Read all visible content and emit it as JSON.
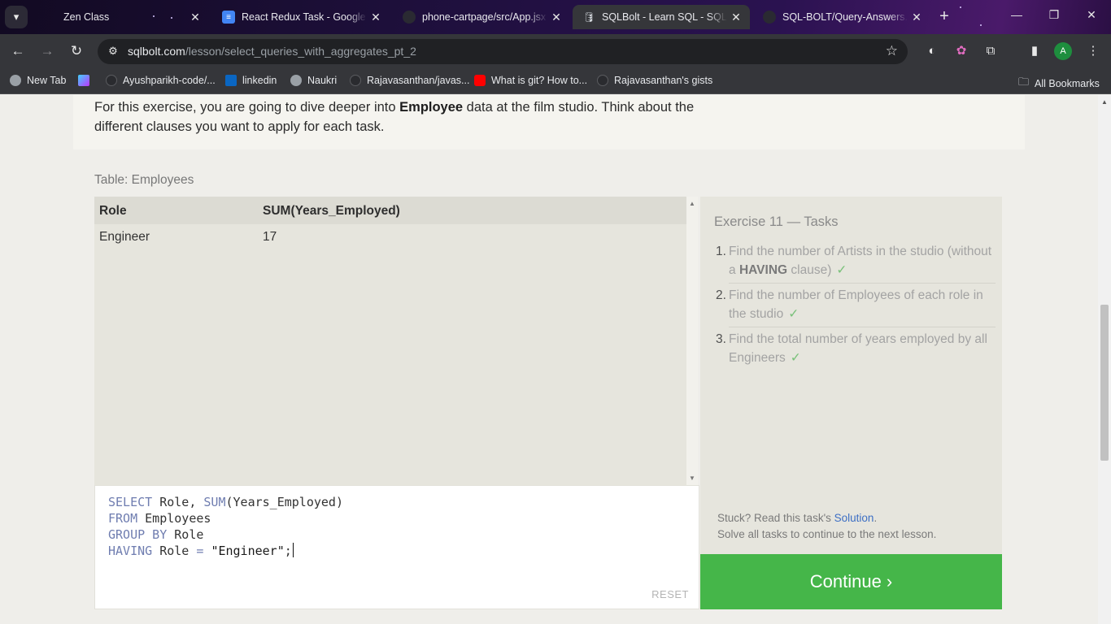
{
  "browser": {
    "tab_menu_icon": "chevron-down-icon",
    "tabs": [
      {
        "title": "Zen Class",
        "favicon": "zen-class-favicon",
        "active": false
      },
      {
        "title": "React Redux Task - Google D",
        "favicon": "google-docs-icon",
        "active": false
      },
      {
        "title": "phone-cartpage/src/App.jsx",
        "favicon": "github-icon",
        "active": false
      },
      {
        "title": "SQLBolt - Learn SQL - SQL L",
        "favicon": "database-icon",
        "active": true
      },
      {
        "title": "SQL-BOLT/Query-Answers.sq",
        "favicon": "github-icon",
        "active": false
      }
    ],
    "new_tab_label": "+",
    "window_controls": {
      "minimize": "—",
      "restore": "❐",
      "close": "✕"
    },
    "url_host": "sqlbolt.com",
    "url_path": "/lesson/select_queries_with_aggregates_pt_2",
    "bookmarks": [
      {
        "label": "New Tab",
        "icon": "globe-icon"
      },
      {
        "label": "",
        "icon": "vite-icon"
      },
      {
        "label": "Ayushparikh-code/...",
        "icon": "github-icon"
      },
      {
        "label": "linkedin",
        "icon": "linkedin-icon"
      },
      {
        "label": "Naukri",
        "icon": "globe-icon"
      },
      {
        "label": "Rajavasanthan/javas...",
        "icon": "github-icon"
      },
      {
        "label": "What is git? How to...",
        "icon": "youtube-icon"
      },
      {
        "label": "Rajavasanthan's gists",
        "icon": "github-icon"
      }
    ],
    "all_bookmarks": "All Bookmarks",
    "profile_initial": "A",
    "colors": {
      "tab_active": "#35363a",
      "toolbar": "#35363a",
      "omnibox": "#202124",
      "profile": "#1e8e3e"
    }
  },
  "lesson": {
    "intro_before": "For this exercise, you are going to dive deeper into ",
    "intro_bold": "Employee",
    "intro_after": " data at the film studio. Think about the different clauses you want to apply for each task.",
    "table_label": "Table: Employees",
    "result": {
      "columns": [
        "Role",
        "SUM(Years_Employed)"
      ],
      "rows": [
        [
          "Engineer",
          "17"
        ]
      ]
    },
    "editor": {
      "lines": [
        [
          {
            "t": "SELECT",
            "k": "kw"
          },
          {
            "t": " Role, ",
            "k": ""
          },
          {
            "t": "SUM",
            "k": "kw"
          },
          {
            "t": "(Years_Employed)",
            "k": ""
          }
        ],
        [
          {
            "t": "FROM",
            "k": "kw"
          },
          {
            "t": " Employees",
            "k": ""
          }
        ],
        [
          {
            "t": "GROUP BY",
            "k": "kw"
          },
          {
            "t": " Role",
            "k": ""
          }
        ],
        [
          {
            "t": "HAVING",
            "k": "kw"
          },
          {
            "t": " Role ",
            "k": ""
          },
          {
            "t": "=",
            "k": "kw"
          },
          {
            "t": " ",
            "k": ""
          },
          {
            "t": "\"Engineer\"",
            "k": "str"
          },
          {
            "t": ";",
            "k": ""
          }
        ]
      ],
      "reset_label": "RESET"
    },
    "tasks": {
      "title": "Exercise 11 — Tasks",
      "items": [
        {
          "num": "1.",
          "text_before": "Find the number of Artists in the studio (without a ",
          "text_bold": "HAVING",
          "text_after": " clause)",
          "check": "✓"
        },
        {
          "num": "2.",
          "text_before": "Find the number of Employees of each role in the studio",
          "text_bold": "",
          "text_after": "",
          "check": "✓"
        },
        {
          "num": "3.",
          "text_before": "Find the total number of years employed by all Engineers",
          "text_bold": "",
          "text_after": "",
          "check": "✓"
        }
      ],
      "stuck_before": "Stuck? Read this task's ",
      "stuck_link": "Solution",
      "stuck_after": ".",
      "stuck_line2": "Solve all tasks to continue to the next lesson."
    },
    "continue_label": "Continue ›",
    "colors": {
      "continue": "#45b649",
      "check": "#7ac17a",
      "link": "#3d6fc4",
      "keyword": "#6f7db0"
    }
  }
}
